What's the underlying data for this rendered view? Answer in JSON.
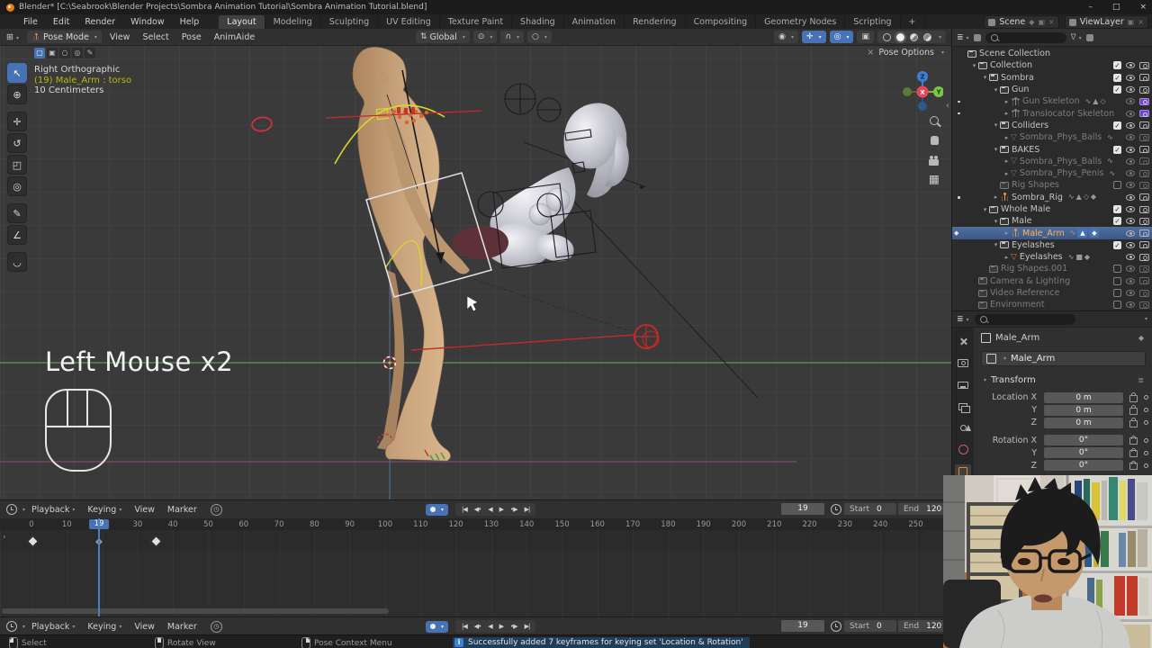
{
  "window": {
    "title": "Blender* [C:\\Seabrook\\Blender Projects\\Sombra Animation Tutorial\\Sombra Animation Tutorial.blend]",
    "controls": {
      "minimize": "–",
      "maximize": "□",
      "close": "×"
    }
  },
  "topbar": {
    "app_menus": [
      "File",
      "Edit",
      "Render",
      "Window",
      "Help"
    ],
    "workspaces": [
      "Layout",
      "Modeling",
      "Sculpting",
      "UV Editing",
      "Texture Paint",
      "Shading",
      "Animation",
      "Rendering",
      "Compositing",
      "Geometry Nodes",
      "Scripting",
      "+"
    ],
    "active_workspace": "Layout",
    "scene": "Scene",
    "view_layer": "ViewLayer"
  },
  "viewport": {
    "header": {
      "mode": "Pose Mode",
      "menus": [
        "View",
        "Select",
        "Pose",
        "AnimAide"
      ],
      "orientation": "Global",
      "active_shading": "solid"
    },
    "select_modes": [
      {
        "name": "tweak",
        "glyph": "▢",
        "active": true
      },
      {
        "name": "select-box",
        "glyph": "▣",
        "active": false
      },
      {
        "name": "select-circle",
        "glyph": "○",
        "active": false
      },
      {
        "name": "select-lasso",
        "glyph": "◎",
        "active": false
      },
      {
        "name": "select-paint",
        "glyph": "✎",
        "active": false
      }
    ],
    "tools": [
      {
        "name": "select-box-tool",
        "glyph": "↖",
        "active": true,
        "group_end": false
      },
      {
        "name": "cursor-tool",
        "glyph": "⊕",
        "active": false,
        "group_end": true
      },
      {
        "name": "move-tool",
        "glyph": "✛",
        "active": false,
        "group_end": false
      },
      {
        "name": "rotate-tool",
        "glyph": "↺",
        "active": false,
        "group_end": false
      },
      {
        "name": "scale-tool",
        "glyph": "◰",
        "active": false,
        "group_end": false
      },
      {
        "name": "transform-tool",
        "glyph": "◎",
        "active": false,
        "group_end": true
      },
      {
        "name": "annotate-tool",
        "glyph": "✎",
        "active": false,
        "group_end": false
      },
      {
        "name": "measure-tool",
        "glyph": "∠",
        "active": false,
        "group_end": true
      },
      {
        "name": "pose-breakdowner-tool",
        "glyph": "◡",
        "active": false,
        "group_end": false
      }
    ],
    "info_lines": [
      "Right Orthographic",
      "(19) Male_Arm : torso",
      "10 Centimeters"
    ],
    "pose_options": "Pose Options",
    "gizmo": {
      "x": "X",
      "y": "Y",
      "z": "Z"
    }
  },
  "outliner": {
    "rows": [
      {
        "label": "Scene Collection",
        "depth": 0,
        "icon": "collection",
        "arrow": null,
        "toggles": {}
      },
      {
        "label": "Collection",
        "depth": 1,
        "icon": "collection",
        "arrow": "open",
        "toggles": {
          "check": true,
          "eye": true,
          "camera": "on"
        }
      },
      {
        "label": "Sombra",
        "depth": 2,
        "icon": "collection",
        "arrow": "open",
        "toggles": {
          "check": true,
          "eye": true,
          "camera": "on"
        }
      },
      {
        "label": "Gun",
        "depth": 3,
        "icon": "collection",
        "arrow": "open",
        "toggles": {
          "check": true,
          "eye": true,
          "camera": "on"
        }
      },
      {
        "label": "Gun Skeleton",
        "depth": 4,
        "icon": "armature",
        "arrow": "closed",
        "greyed": true,
        "dot": true,
        "extras": [
          "action",
          "pose",
          "constraint"
        ],
        "toggles": {
          "eye": true,
          "camera": "purple"
        }
      },
      {
        "label": "Translocator Skeleton",
        "depth": 4,
        "icon": "armature",
        "arrow": "closed",
        "greyed": true,
        "dot": true,
        "extras": [],
        "toggles": {
          "eye": true,
          "camera": "purple"
        }
      },
      {
        "label": "Colliders",
        "depth": 3,
        "icon": "collection",
        "arrow": "open",
        "toggles": {
          "check": true,
          "eye": true,
          "camera": "on"
        }
      },
      {
        "label": "Sombra_Phys_Balls",
        "depth": 4,
        "icon": "mesh",
        "arrow": "closed",
        "greyed": true,
        "extras": [
          "action"
        ],
        "toggles": {
          "eye": true,
          "camera": "off"
        }
      },
      {
        "label": "BAKES",
        "depth": 3,
        "icon": "collection",
        "arrow": "open",
        "toggles": {
          "check": true,
          "eye": true,
          "camera": "on"
        }
      },
      {
        "label": "Sombra_Phys_Balls",
        "depth": 4,
        "icon": "mesh",
        "arrow": "closed",
        "greyed": true,
        "extras": [
          "action"
        ],
        "toggles": {
          "eye": true,
          "camera": "off"
        }
      },
      {
        "label": "Sombra_Phys_Penis",
        "depth": 4,
        "icon": "mesh",
        "arrow": "closed",
        "greyed": true,
        "extras": [
          "action"
        ],
        "toggles": {
          "eye": true,
          "camera": "off"
        }
      },
      {
        "label": "Rig Shapes",
        "depth": 3,
        "icon": "collection",
        "arrow": null,
        "greyed": true,
        "toggles": {
          "check": false,
          "eye": true,
          "camera": "off"
        }
      },
      {
        "label": "Sombra_Rig",
        "depth": 3,
        "icon": "armature",
        "arrow": "closed",
        "dot": true,
        "extras": [
          "action",
          "pose",
          "constraint",
          "data"
        ],
        "toggles": {
          "eye": true,
          "camera": "on"
        }
      },
      {
        "label": "Whole Male",
        "depth": 2,
        "icon": "collection",
        "arrow": "open",
        "toggles": {
          "check": true,
          "eye": true,
          "camera": "on"
        }
      },
      {
        "label": "Male",
        "depth": 3,
        "icon": "collection",
        "arrow": "open",
        "toggles": {
          "check": true,
          "eye": true,
          "camera": "on"
        }
      },
      {
        "label": "Male_Arm",
        "depth": 4,
        "icon": "armature",
        "arrow": "closed",
        "selected": true,
        "marker": "pose",
        "extras": [
          "action",
          "pose-active",
          "data-active"
        ],
        "toggles": {
          "eye": true,
          "camera": "on"
        }
      },
      {
        "label": "Eyelashes",
        "depth": 3,
        "icon": "collection",
        "arrow": "open",
        "toggles": {
          "check": true,
          "eye": true,
          "camera": "on"
        }
      },
      {
        "label": "Eyelashes",
        "depth": 4,
        "icon": "mesh",
        "arrow": "closed",
        "extras": [
          "action",
          "modifier",
          "data"
        ],
        "toggles": {
          "eye": true,
          "camera": "on"
        }
      },
      {
        "label": "Rig Shapes.001",
        "depth": 2,
        "icon": "collection",
        "arrow": null,
        "greyed": true,
        "toggles": {
          "check": false,
          "eye": true,
          "camera": "off"
        }
      },
      {
        "label": "Camera & Lighting",
        "depth": 1,
        "icon": "collection",
        "arrow": null,
        "greyed": true,
        "toggles": {
          "check": false,
          "eye": true,
          "camera": "on"
        }
      },
      {
        "label": "Video Reference",
        "depth": 1,
        "icon": "collection",
        "arrow": null,
        "greyed": true,
        "toggles": {
          "check": false,
          "eye": true,
          "camera": "on"
        }
      },
      {
        "label": "Environment",
        "depth": 1,
        "icon": "collection",
        "arrow": null,
        "greyed": true,
        "toggles": {
          "check": false,
          "eye": true,
          "camera": "on"
        }
      }
    ]
  },
  "properties": {
    "tabs": [
      "tool",
      "render",
      "output",
      "layers",
      "scene",
      "world",
      "object",
      "constraints"
    ],
    "active_tab": "object",
    "breadcrumb": "Male_Arm",
    "object_name": "Male_Arm",
    "panel_title": "Transform",
    "rows": [
      {
        "label": "Location X",
        "value": "0 m",
        "gap": false
      },
      {
        "label": "Y",
        "value": "0 m",
        "gap": false
      },
      {
        "label": "Z",
        "value": "0 m",
        "gap": false
      },
      {
        "label": "Rotation X",
        "value": "0°",
        "gap": true
      },
      {
        "label": "Y",
        "value": "0°",
        "gap": false
      },
      {
        "label": "Z",
        "value": "0°",
        "gap": false
      }
    ]
  },
  "timeline": {
    "menus": [
      "Playback",
      "Keying",
      "View",
      "Marker"
    ],
    "ticks": [
      0,
      10,
      30,
      40,
      50,
      60,
      70,
      80,
      90,
      100,
      110,
      120,
      130,
      140,
      150,
      160,
      170,
      180,
      190,
      200,
      210,
      220,
      230,
      240,
      250
    ],
    "current_frame": 19,
    "frame_display": "19",
    "start_label": "Start",
    "start_value": "0",
    "end_label": "End",
    "end_value": "120",
    "keyframes": [
      {
        "frame": 0,
        "selected": true
      },
      {
        "frame": 19,
        "selected": false
      },
      {
        "frame": 35,
        "selected": true
      }
    ],
    "transport": [
      {
        "name": "jump-to-start",
        "glyph": "|◀"
      },
      {
        "name": "prev-keyframe",
        "glyph": "◀•"
      },
      {
        "name": "play-reverse",
        "glyph": "◀"
      },
      {
        "name": "play",
        "glyph": "▶"
      },
      {
        "name": "next-keyframe",
        "glyph": "•▶"
      },
      {
        "name": "jump-to-end",
        "glyph": "▶|"
      }
    ]
  },
  "statusbar": {
    "hints": [
      {
        "label": "Select",
        "button": "left"
      },
      {
        "label": "Rotate View",
        "button": "middle"
      },
      {
        "label": "Pose Context Menu",
        "button": "right"
      }
    ],
    "message": "Successfully added 7 keyframes for keying set 'Location & Rotation'"
  },
  "screencast": {
    "text": "Left Mouse x2"
  },
  "colors": {
    "accent": "#4772b3",
    "selected_object": "#ffb25f",
    "axis_y_green": "#5d9960",
    "floor_magenta": "#9c5188",
    "playhead": "#4a80c0"
  }
}
